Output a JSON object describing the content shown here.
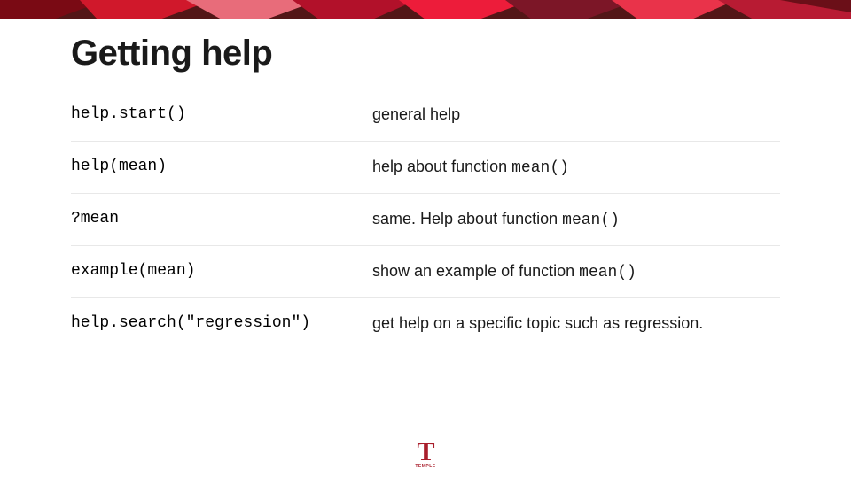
{
  "title": "Getting help",
  "rows": [
    {
      "cmd": "help.start()",
      "desc_pre": "general help",
      "mono": "",
      "desc_post": ""
    },
    {
      "cmd": "help(mean)",
      "desc_pre": "help about function ",
      "mono": "mean()",
      "desc_post": ""
    },
    {
      "cmd": "?mean",
      "desc_pre": "same. Help about function ",
      "mono": "mean()",
      "desc_post": ""
    },
    {
      "cmd": "example(mean)",
      "desc_pre": "show an example of function ",
      "mono": "mean()",
      "desc_post": ""
    },
    {
      "cmd": "help.search(\"regression\")",
      "desc_pre": "get help on a specific topic such as regression.",
      "mono": "",
      "desc_post": ""
    }
  ],
  "logo": {
    "mark": "T",
    "university": "TEMPLE"
  },
  "colors": {
    "brand": "#a91e2c"
  }
}
